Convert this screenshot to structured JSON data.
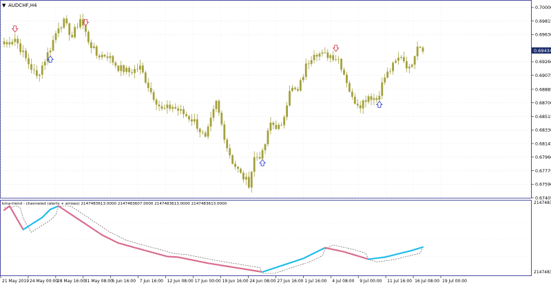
{
  "main_chart": {
    "symbol_label": "AUDCHF,H4",
    "current_price": "0.69434",
    "price_ticks": [
      "0.70000",
      "0.69815",
      "0.69630",
      "0.69434",
      "0.69260",
      "0.69075",
      "0.68885",
      "0.68700",
      "0.68515",
      "0.68330",
      "0.68145",
      "0.67960",
      "0.67775",
      "0.67590",
      "0.67405"
    ],
    "time_labels": [
      "21 May 2019",
      "24 May 00:00",
      "28 May 16:00",
      "31 May 08:00",
      "5 Jun 16:00",
      "7 Jun 16:00",
      "12 Jun 08:00",
      "17 Jun 00:00",
      "19 Jun 16:00",
      "24 Jun 08:00",
      "27 Jun 16:00",
      "1 Jul 16:00",
      "4 Jul 08:00",
      "9 Jul 00:00",
      "11 Jul 16:00",
      "16 Jul 08:00",
      "19 Jul 00:00"
    ],
    "arrow_signals": [
      {
        "direction": "down",
        "index": 4
      },
      {
        "direction": "up",
        "index": 17
      },
      {
        "direction": "down",
        "index": 30
      },
      {
        "direction": "up",
        "index": 95
      },
      {
        "direction": "down",
        "index": 122
      },
      {
        "direction": "up",
        "index": 138
      }
    ]
  },
  "indicator_panel": {
    "label": "kma-trend - channeled (alerts + arrows) 2147483613.0000 2147483607.0000 2147483613.0000 2147483613.0000",
    "ticks": [
      "2147483648",
      "2147483648"
    ]
  },
  "colors": {
    "candle": "#a3a03c",
    "trend_up": "#22bde8",
    "trend_down": "#d96d8c",
    "channel": "#444444",
    "arrow_up": "#2233cc",
    "arrow_down": "#cc2233",
    "frame": "#4a4aa0",
    "label_bg": "#1c2f6e"
  },
  "chart_data": {
    "type": "candlestick",
    "title": "AUDCHF,H4",
    "ylim": [
      0.67405,
      0.70093
    ],
    "bars_count": 155,
    "close_anchors": [
      [
        0,
        0.695
      ],
      [
        4,
        0.6958
      ],
      [
        8,
        0.693
      ],
      [
        12,
        0.6905
      ],
      [
        17,
        0.6945
      ],
      [
        20,
        0.6975
      ],
      [
        22,
        0.698
      ],
      [
        25,
        0.696
      ],
      [
        28,
        0.6985
      ],
      [
        31,
        0.6955
      ],
      [
        34,
        0.6935
      ],
      [
        38,
        0.6935
      ],
      [
        42,
        0.6918
      ],
      [
        46,
        0.6912
      ],
      [
        50,
        0.6918
      ],
      [
        54,
        0.6885
      ],
      [
        58,
        0.686
      ],
      [
        62,
        0.6865
      ],
      [
        66,
        0.6855
      ],
      [
        70,
        0.6845
      ],
      [
        74,
        0.682
      ],
      [
        78,
        0.687
      ],
      [
        82,
        0.681
      ],
      [
        84,
        0.679
      ],
      [
        87,
        0.6772
      ],
      [
        90,
        0.676
      ],
      [
        92,
        0.6795
      ],
      [
        95,
        0.68
      ],
      [
        98,
        0.6842
      ],
      [
        102,
        0.6835
      ],
      [
        105,
        0.689
      ],
      [
        108,
        0.6885
      ],
      [
        111,
        0.692
      ],
      [
        114,
        0.694
      ],
      [
        117,
        0.6935
      ],
      [
        120,
        0.6935
      ],
      [
        123,
        0.693
      ],
      [
        126,
        0.69
      ],
      [
        128,
        0.6875
      ],
      [
        131,
        0.6868
      ],
      [
        134,
        0.688
      ],
      [
        137,
        0.6875
      ],
      [
        140,
        0.6905
      ],
      [
        143,
        0.692
      ],
      [
        146,
        0.6935
      ],
      [
        149,
        0.6915
      ],
      [
        152,
        0.695
      ],
      [
        154,
        0.6945
      ]
    ],
    "indicator_trend": {
      "points": [
        [
          0,
          0.94
        ],
        [
          2,
          1.0
        ],
        [
          7,
          0.65
        ],
        [
          14,
          0.83
        ],
        [
          17,
          0.95
        ],
        [
          20,
          1.0
        ],
        [
          36,
          0.57
        ],
        [
          42,
          0.45
        ],
        [
          50,
          0.36
        ],
        [
          60,
          0.25
        ],
        [
          64,
          0.24
        ],
        [
          75,
          0.15
        ],
        [
          95,
          0.02
        ],
        [
          110,
          0.22
        ],
        [
          118,
          0.38
        ],
        [
          125,
          0.32
        ],
        [
          134,
          0.21
        ],
        [
          140,
          0.24
        ],
        [
          150,
          0.34
        ],
        [
          154,
          0.39
        ]
      ],
      "up_segments": [
        [
          7,
          20
        ],
        [
          95,
          118
        ],
        [
          134,
          154
        ]
      ]
    }
  }
}
